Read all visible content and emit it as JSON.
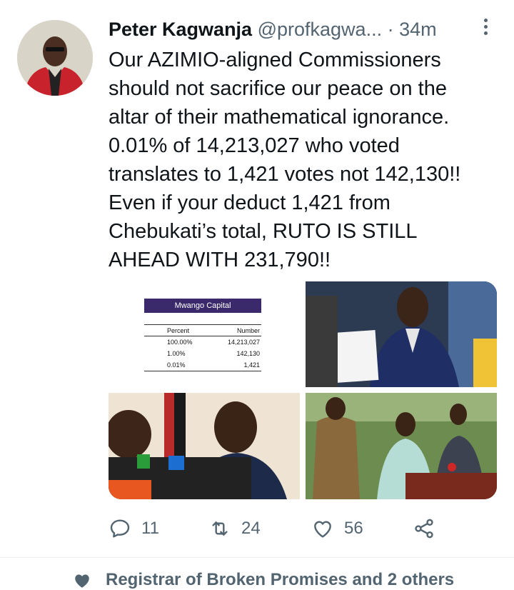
{
  "tweet": {
    "author_name": "Peter Kagwanja",
    "handle": "@profkagwa...",
    "separator": "·",
    "time": "34m",
    "text_lines": [
      "Our AZIMIO-aligned Commissioners",
      "should not sacrifice our peace on the",
      "altar of their mathematical ignorance.",
      "0.01% of 14,213,027 who voted",
      "translates to 1,421 votes not 142,130!!",
      "Even if your deduct 1,421 from",
      "Chebukati’s total, RUTO IS STILL",
      "AHEAD WITH 231,790!!"
    ]
  },
  "media": {
    "table_title": "Mwango Capital",
    "table_headers": [
      "Percent",
      "Number"
    ],
    "table_rows": [
      [
        "100.00%",
        "14,213,027"
      ],
      [
        "1.00%",
        "142,130"
      ],
      [
        "0.01%",
        "1,421"
      ]
    ]
  },
  "actions": {
    "reply_count": "11",
    "retweet_count": "24",
    "like_count": "56"
  },
  "footer": {
    "liked_by": "Registrar of Broken Promises and 2 others"
  },
  "colors": {
    "text": "#0f1419",
    "secondary": "#536471",
    "table_header_bg": "#3b2a6b"
  }
}
